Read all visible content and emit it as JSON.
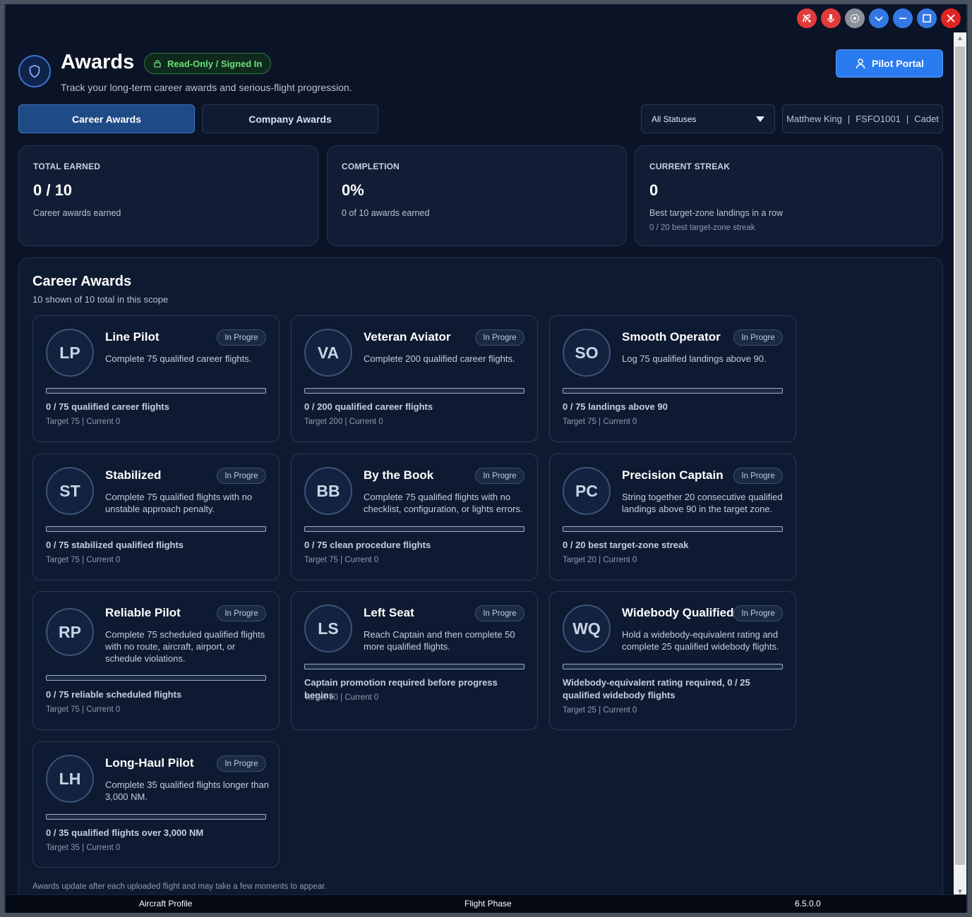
{
  "header": {
    "title": "Awards",
    "mode_badge": "Read-Only / Signed In",
    "subtitle": "Track your long-term career awards and serious-flight progression.",
    "portal_button": "Pilot Portal"
  },
  "tabs": [
    {
      "label": "Career Awards",
      "active": true
    },
    {
      "label": "Company Awards",
      "active": false
    }
  ],
  "filter": {
    "selected": "All Statuses"
  },
  "user": {
    "name": "Matthew King",
    "id": "FSFO1001",
    "rank": "Cadet",
    "sep": "|"
  },
  "stats": [
    {
      "label": "TOTAL EARNED",
      "value": "0 / 10",
      "desc": "Career awards earned",
      "desc2": ""
    },
    {
      "label": "COMPLETION",
      "value": "0%",
      "desc": "0 of 10 awards earned",
      "desc2": ""
    },
    {
      "label": "CURRENT STREAK",
      "value": "0",
      "desc": "Best target-zone landings in a row",
      "desc2": "0 / 20 best target-zone streak"
    }
  ],
  "panel": {
    "title": "Career Awards",
    "subtitle": "10 shown of 10 total in this scope",
    "footnote": "Awards update after each uploaded flight and may take a few moments to appear."
  },
  "awards": [
    {
      "initials": "LP",
      "name": "Line Pilot",
      "status": "In Progre",
      "desc": "Complete 75 qualified career flights.",
      "progress_text": "0 / 75 qualified career flights",
      "target": "Target 75 | Current 0",
      "progress": 0
    },
    {
      "initials": "VA",
      "name": "Veteran Aviator",
      "status": "In Progre",
      "desc": "Complete 200 qualified career flights.",
      "progress_text": "0 / 200 qualified career flights",
      "target": "Target 200 | Current 0",
      "progress": 0
    },
    {
      "initials": "SO",
      "name": "Smooth Operator",
      "status": "In Progre",
      "desc": "Log 75 qualified landings above 90.",
      "progress_text": "0 / 75 landings above 90",
      "target": "Target 75 | Current 0",
      "progress": 0
    },
    {
      "initials": "ST",
      "name": "Stabilized",
      "status": "In Progre",
      "desc": "Complete 75 qualified flights with no unstable approach penalty.",
      "progress_text": "0 / 75 stabilized qualified flights",
      "target": "Target 75 | Current 0",
      "progress": 0
    },
    {
      "initials": "BB",
      "name": "By the Book",
      "status": "In Progre",
      "desc": "Complete 75 qualified flights with no checklist, configuration, or lights errors.",
      "progress_text": "0 / 75 clean procedure flights",
      "target": "Target 75 | Current 0",
      "progress": 0
    },
    {
      "initials": "PC",
      "name": "Precision Captain",
      "status": "In Progre",
      "desc": "String together 20 consecutive qualified landings above 90 in the target zone.",
      "progress_text": "0 / 20 best target-zone streak",
      "target": "Target 20 | Current 0",
      "progress": 0
    },
    {
      "initials": "RP",
      "name": "Reliable Pilot",
      "status": "In Progre",
      "desc": "Complete 75 scheduled qualified flights with no route, aircraft, airport, or schedule violations.",
      "progress_text": "0 / 75 reliable scheduled flights",
      "target": "Target 75 | Current 0",
      "progress": 0
    },
    {
      "initials": "LS",
      "name": "Left Seat",
      "status": "In Progre",
      "desc": "Reach Captain and then complete 50 more qualified flights.",
      "progress_text": "Captain promotion required before progress begins",
      "target": "Target 50 | Current 0",
      "progress": 0
    },
    {
      "initials": "WQ",
      "name": "Widebody Qualified",
      "status": "In Progre",
      "desc": "Hold a widebody-equivalent rating and complete 25 qualified widebody flights.",
      "progress_text": "Widebody-equivalent rating required, 0 / 25 qualified widebody flights",
      "target": "Target 25 | Current 0",
      "progress": 0
    },
    {
      "initials": "LH",
      "name": "Long-Haul Pilot",
      "status": "In Progre",
      "desc": "Complete 35 qualified flights longer than 3,000 NM.",
      "progress_text": "0 / 35 qualified flights over 3,000 NM",
      "target": "Target 35 | Current 0",
      "progress": 0
    }
  ],
  "statusbar": {
    "left": "Aircraft Profile",
    "center": "Flight Phase",
    "right": "6.5.0.0"
  },
  "window_controls": [
    "signal-off-icon",
    "mic-off-icon",
    "settings-icon",
    "chevron-down-icon",
    "minimize-icon",
    "maximize-icon",
    "close-icon"
  ],
  "colors": {
    "accent": "#2b7bf0",
    "success": "#6ee07a",
    "background": "#0b1426"
  }
}
